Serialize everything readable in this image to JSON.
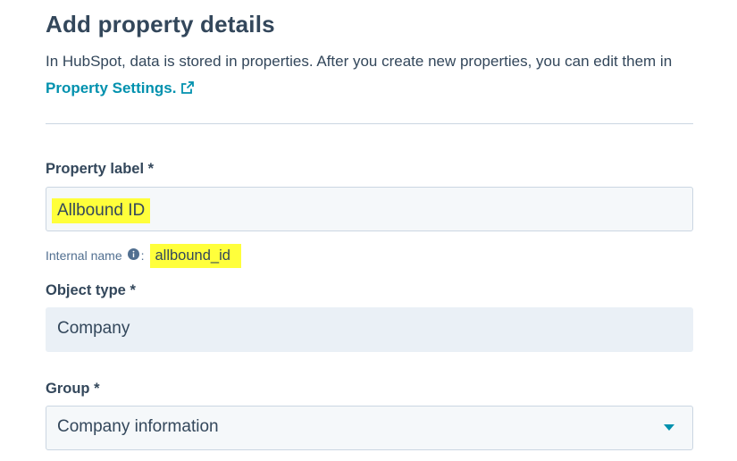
{
  "header": {
    "title": "Add property details",
    "intro_text": "In HubSpot, data is stored in properties. After you create new properties, you can edit them in ",
    "link_label": "Property Settings."
  },
  "form": {
    "property_label": {
      "label": "Property label *",
      "value": "Allbound ID"
    },
    "internal_name": {
      "label": "Internal name",
      "value": "allbound_id"
    },
    "object_type": {
      "label": "Object type *",
      "value": "Company"
    },
    "group": {
      "label": "Group *",
      "value": "Company information"
    }
  },
  "colors": {
    "text": "#33475b",
    "link": "#0091ae",
    "highlight": "#ffff3b",
    "input_bg": "#f5f8fa",
    "readonly_bg": "#eaf0f6",
    "border": "#cbd6e2"
  },
  "icons": {
    "link": "external-link-icon",
    "info": "info-icon",
    "dropdown": "caret-down-icon"
  }
}
